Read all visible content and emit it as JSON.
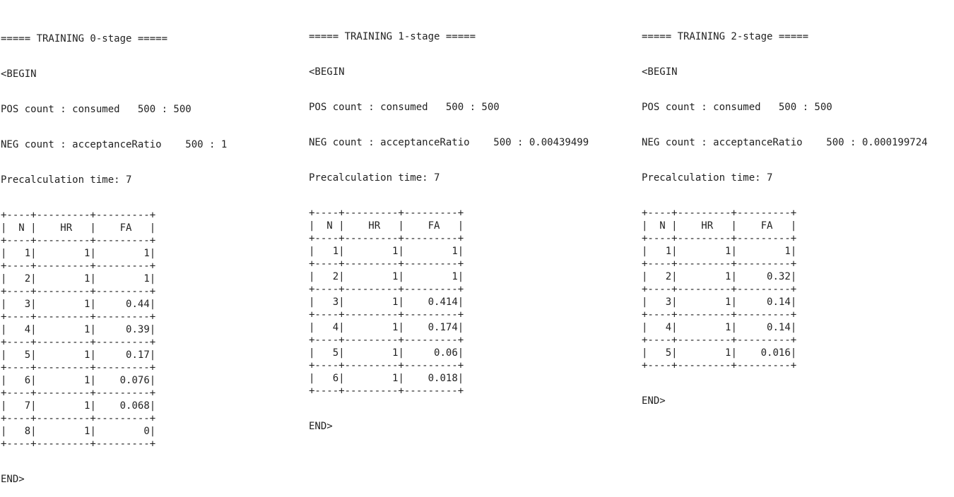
{
  "stages": [
    {
      "header": "===== TRAINING 0-stage =====",
      "begin": "<BEGIN",
      "pos_count": "POS count : consumed   500 : 500",
      "neg_count": "NEG count : acceptanceRatio    500 : 1",
      "precalc": "Precalculation time: 7",
      "table_border": "+----+---------+---------+",
      "table_header": "|  N |    HR   |    FA   |",
      "rows": [
        {
          "n": "1",
          "hr": "1",
          "fa": "1"
        },
        {
          "n": "2",
          "hr": "1",
          "fa": "1"
        },
        {
          "n": "3",
          "hr": "1",
          "fa": "0.44"
        },
        {
          "n": "4",
          "hr": "1",
          "fa": "0.39"
        },
        {
          "n": "5",
          "hr": "1",
          "fa": "0.17"
        },
        {
          "n": "6",
          "hr": "1",
          "fa": "0.076"
        },
        {
          "n": "7",
          "hr": "1",
          "fa": "0.068"
        },
        {
          "n": "8",
          "hr": "1",
          "fa": "0"
        }
      ],
      "end": "END>"
    },
    {
      "header": "===== TRAINING 1-stage =====",
      "begin": "<BEGIN",
      "pos_count": "POS count : consumed   500 : 500",
      "neg_count": "NEG count : acceptanceRatio    500 : 0.00439499",
      "precalc": "Precalculation time: 7",
      "table_border": "+----+---------+---------+",
      "table_header": "|  N |    HR   |    FA   |",
      "rows": [
        {
          "n": "1",
          "hr": "1",
          "fa": "1"
        },
        {
          "n": "2",
          "hr": "1",
          "fa": "1"
        },
        {
          "n": "3",
          "hr": "1",
          "fa": "0.414"
        },
        {
          "n": "4",
          "hr": "1",
          "fa": "0.174"
        },
        {
          "n": "5",
          "hr": "1",
          "fa": "0.06"
        },
        {
          "n": "6",
          "hr": "1",
          "fa": "0.018"
        }
      ],
      "end": "END>"
    },
    {
      "header": "===== TRAINING 2-stage =====",
      "begin": "<BEGIN",
      "pos_count": "POS count : consumed   500 : 500",
      "neg_count": "NEG count : acceptanceRatio    500 : 0.000199724",
      "precalc": "Precalculation time: 7",
      "table_border": "+----+---------+---------+",
      "table_header": "|  N |    HR   |    FA   |",
      "rows": [
        {
          "n": "1",
          "hr": "1",
          "fa": "1"
        },
        {
          "n": "2",
          "hr": "1",
          "fa": "0.32"
        },
        {
          "n": "3",
          "hr": "1",
          "fa": "0.14"
        },
        {
          "n": "4",
          "hr": "1",
          "fa": "0.14"
        },
        {
          "n": "5",
          "hr": "1",
          "fa": "0.016"
        }
      ],
      "end": "END>"
    }
  ]
}
